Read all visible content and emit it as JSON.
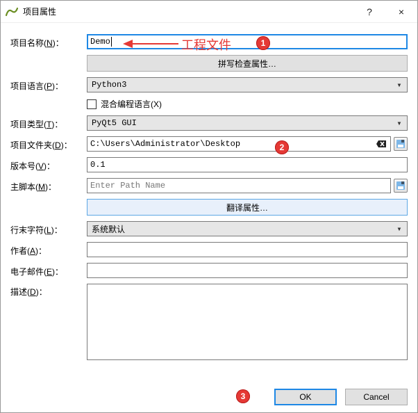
{
  "window": {
    "title": "项目属性",
    "help_symbol": "?",
    "close_symbol": "×"
  },
  "labels": {
    "name": "项目名称",
    "name_mn": "N",
    "lang": "项目语言",
    "lang_mn": "P",
    "mixed": "混合编程语言",
    "mixed_mn": "X",
    "type": "项目类型",
    "type_mn": "T",
    "folder": "项目文件夹",
    "folder_mn": "D",
    "version": "版本号",
    "version_mn": "V",
    "mainscript": "主脚本",
    "mainscript_mn": "M",
    "eol": "行末字符",
    "eol_mn": "L",
    "author": "作者",
    "author_mn": "A",
    "email": "电子邮件",
    "email_mn": "E",
    "desc": "描述",
    "desc_mn": "D",
    "colon": "："
  },
  "fields": {
    "name_value": "Demo",
    "spellcheck_btn": "拼写检查属性…",
    "lang_value": "Python3",
    "type_value": "PyQt5 GUI",
    "folder_value": "C:\\Users\\Administrator\\Desktop",
    "version_value": "0.1",
    "mainscript_placeholder": "Enter Path Name",
    "translate_btn": "翻译属性…",
    "eol_value": "系统默认",
    "author_value": "",
    "email_value": "",
    "desc_value": ""
  },
  "footer": {
    "ok": "OK",
    "cancel": "Cancel"
  },
  "annotations": {
    "text1": "工程文件",
    "badge1": "1",
    "badge2": "2",
    "badge3": "3"
  }
}
